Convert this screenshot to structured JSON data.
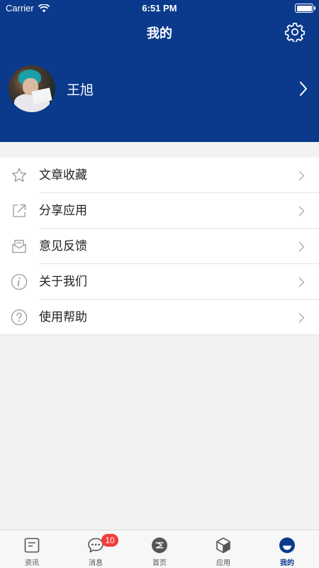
{
  "status_bar": {
    "carrier": "Carrier",
    "time": "6:51 PM"
  },
  "header": {
    "title": "我的"
  },
  "profile": {
    "name": "王旭"
  },
  "menu": [
    {
      "label": "文章收藏",
      "icon": "star-icon"
    },
    {
      "label": "分享应用",
      "icon": "share-icon"
    },
    {
      "label": "意见反馈",
      "icon": "feedback-icon"
    },
    {
      "label": "关于我们",
      "icon": "info-icon"
    },
    {
      "label": "使用帮助",
      "icon": "help-icon"
    }
  ],
  "tabbar": {
    "tabs": [
      {
        "label": "资讯",
        "icon": "news-icon"
      },
      {
        "label": "消息",
        "icon": "message-icon",
        "badge": "10"
      },
      {
        "label": "首页",
        "icon": "home-icon"
      },
      {
        "label": "应用",
        "icon": "apps-icon"
      },
      {
        "label": "我的",
        "icon": "profile-icon",
        "active": true
      }
    ]
  },
  "colors": {
    "brand": "#0b3a8c",
    "badge": "#f23c3c",
    "background": "#f2f2f2"
  }
}
